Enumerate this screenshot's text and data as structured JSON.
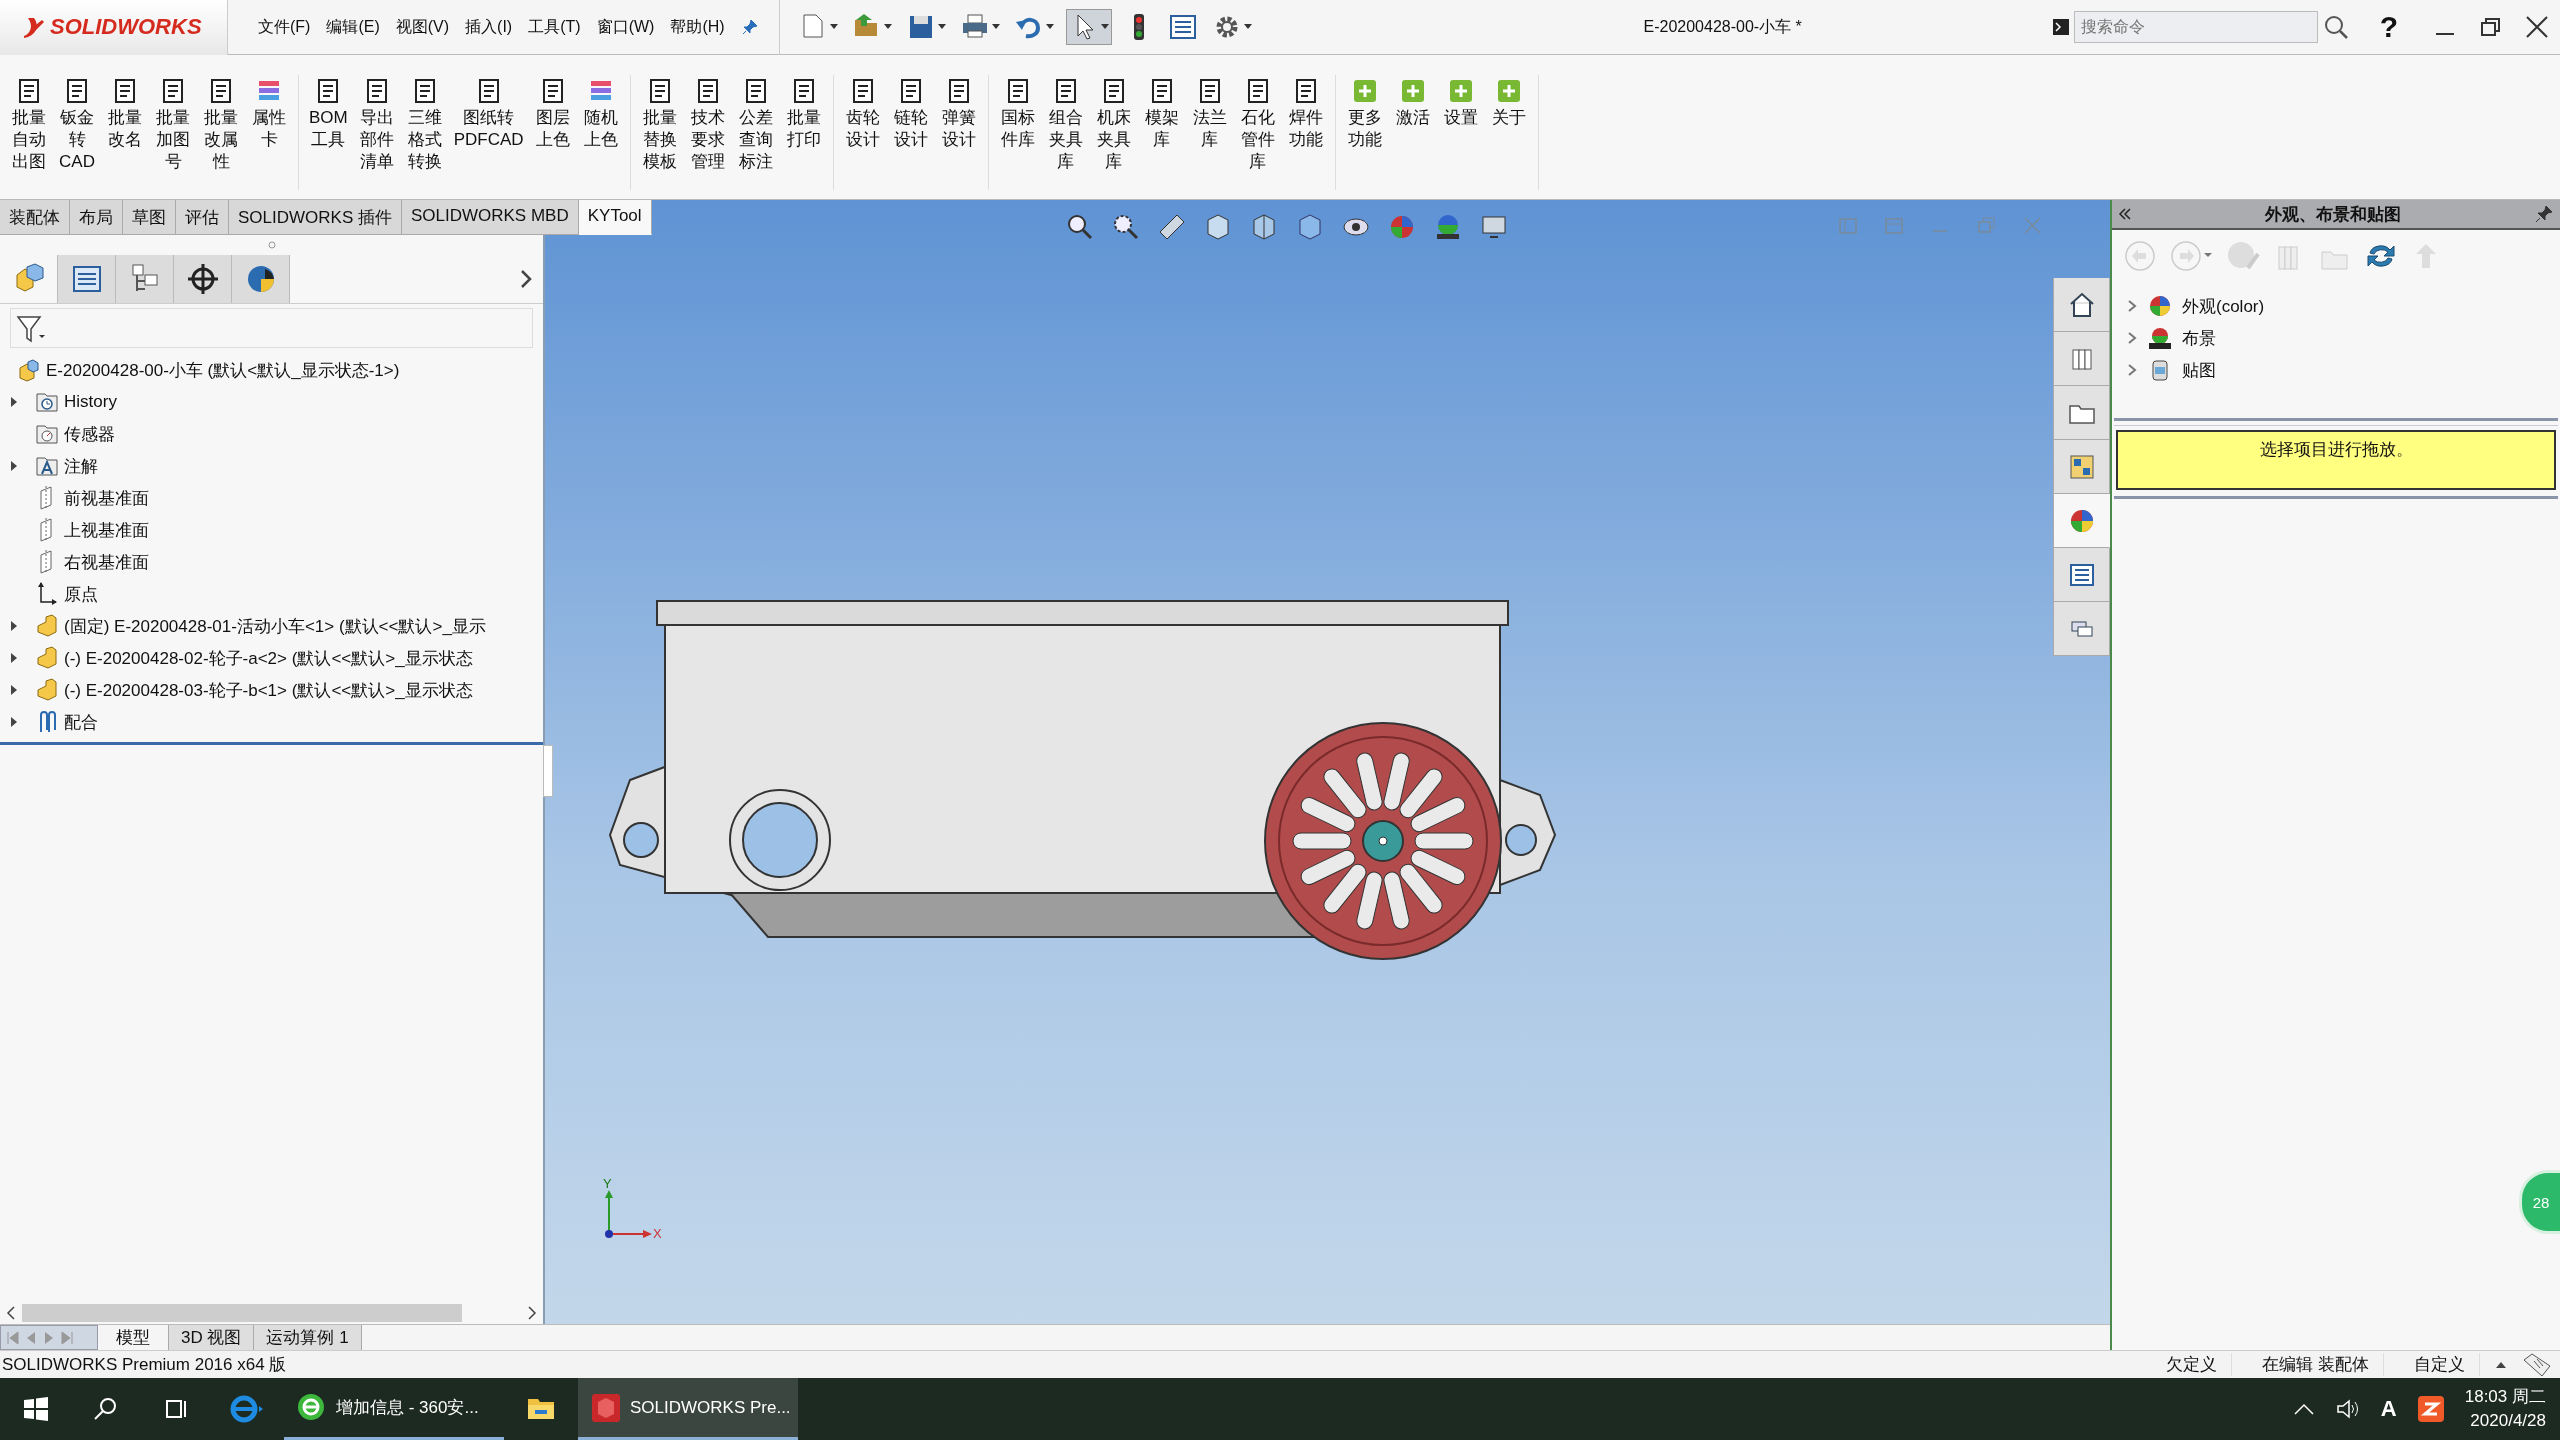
{
  "logo": {
    "text": "SOLIDWORKS"
  },
  "menu": [
    "文件(F)",
    "编辑(E)",
    "视图(V)",
    "插入(I)",
    "工具(T)",
    "窗口(W)",
    "帮助(H)"
  ],
  "window": {
    "title": "E-20200428-00-小车 *"
  },
  "search": {
    "placeholder": "搜索命令"
  },
  "help": "?",
  "ribbon": {
    "groups": [
      [
        {
          "kind": "tool",
          "lines": [
            "批量",
            "自动",
            "出图"
          ]
        },
        {
          "kind": "tool",
          "lines": [
            "钣金",
            "转",
            "CAD"
          ]
        },
        {
          "kind": "tool",
          "lines": [
            "批量",
            "改名"
          ]
        },
        {
          "kind": "tool",
          "lines": [
            "批量",
            "加图",
            "号"
          ]
        },
        {
          "kind": "tool",
          "lines": [
            "批量",
            "改属",
            "性"
          ]
        },
        {
          "kind": "color",
          "lines": [
            "属性",
            "卡"
          ]
        }
      ],
      [
        {
          "kind": "tool",
          "lines": [
            "BOM",
            "工具"
          ]
        },
        {
          "kind": "tool",
          "lines": [
            "导出",
            "部件",
            "清单"
          ]
        },
        {
          "kind": "tool",
          "lines": [
            "三维",
            "格式",
            "转换"
          ]
        },
        {
          "kind": "tool",
          "lines": [
            "图纸转",
            "PDFCAD"
          ]
        },
        {
          "kind": "tool",
          "lines": [
            "图层",
            "上色"
          ]
        },
        {
          "kind": "color",
          "lines": [
            "随机",
            "上色"
          ]
        }
      ],
      [
        {
          "kind": "tool",
          "lines": [
            "批量",
            "替换",
            "模板"
          ]
        },
        {
          "kind": "tool",
          "lines": [
            "技术",
            "要求",
            "管理"
          ]
        },
        {
          "kind": "tool",
          "lines": [
            "公差",
            "查询",
            "标注"
          ]
        },
        {
          "kind": "tool",
          "lines": [
            "批量",
            "打印"
          ]
        }
      ],
      [
        {
          "kind": "tool",
          "lines": [
            "齿轮",
            "设计"
          ]
        },
        {
          "kind": "tool",
          "lines": [
            "链轮",
            "设计"
          ]
        },
        {
          "kind": "tool",
          "lines": [
            "弹簧",
            "设计"
          ]
        }
      ],
      [
        {
          "kind": "tool",
          "lines": [
            "国标",
            "件库"
          ]
        },
        {
          "kind": "tool",
          "lines": [
            "组合",
            "夹具",
            "库"
          ]
        },
        {
          "kind": "tool",
          "lines": [
            "机床",
            "夹具",
            "库"
          ]
        },
        {
          "kind": "tool",
          "lines": [
            "模架",
            "库"
          ]
        },
        {
          "kind": "tool",
          "lines": [
            "法兰",
            "库"
          ]
        },
        {
          "kind": "tool",
          "lines": [
            "石化",
            "管件",
            "库"
          ]
        },
        {
          "kind": "tool",
          "lines": [
            "焊件",
            "功能"
          ]
        }
      ],
      [
        {
          "kind": "addon",
          "lines": [
            "更多",
            "功能"
          ]
        },
        {
          "kind": "addon",
          "lines": [
            "激活"
          ]
        },
        {
          "kind": "addon",
          "lines": [
            "设置"
          ]
        },
        {
          "kind": "addon",
          "lines": [
            "关于"
          ]
        }
      ]
    ]
  },
  "command_tabs": [
    {
      "label": "装配体",
      "selected": false
    },
    {
      "label": "布局",
      "selected": false
    },
    {
      "label": "草图",
      "selected": false
    },
    {
      "label": "评估",
      "selected": false
    },
    {
      "label": "SOLIDWORKS 插件",
      "selected": false
    },
    {
      "label": "SOLIDWORKS MBD",
      "selected": false
    },
    {
      "label": "KYTool",
      "selected": true
    }
  ],
  "panel_tabs": [
    {
      "kind": "features",
      "selected": true
    },
    {
      "kind": "properties",
      "selected": false
    },
    {
      "kind": "config",
      "selected": false
    },
    {
      "kind": "dimxpert",
      "selected": false
    },
    {
      "kind": "display",
      "selected": false
    }
  ],
  "tree": {
    "root": {
      "kind": "assembly",
      "label": "E-20200428-00-小车 (默认<默认_显示状态-1>)",
      "children": [
        {
          "kind": "history",
          "label": "History",
          "expanded": false
        },
        {
          "kind": "sensor",
          "label": "传感器"
        },
        {
          "kind": "annotation",
          "label": "注解",
          "expanded": false
        },
        {
          "kind": "plane",
          "label": "前视基准面"
        },
        {
          "kind": "plane",
          "label": "上视基准面"
        },
        {
          "kind": "plane",
          "label": "右视基准面"
        },
        {
          "kind": "origin",
          "label": "原点"
        },
        {
          "kind": "part",
          "label": "(固定) E-20200428-01-活动小车<1> (默认<<默认>_显示",
          "expanded": false
        },
        {
          "kind": "part",
          "label": "(-) E-20200428-02-轮子-a<2> (默认<<默认>_显示状态",
          "expanded": false
        },
        {
          "kind": "part",
          "label": "(-) E-20200428-03-轮子-b<1> (默认<<默认>_显示状态",
          "expanded": false
        },
        {
          "kind": "mates",
          "label": "配合",
          "expanded": false
        }
      ]
    }
  },
  "viewport": {
    "triad": {
      "x": "X",
      "y": "Y"
    }
  },
  "task_tabs": [
    {
      "kind": "home",
      "selected": false
    },
    {
      "kind": "library",
      "selected": false
    },
    {
      "kind": "folder",
      "selected": false
    },
    {
      "kind": "palette",
      "selected": false
    },
    {
      "kind": "appearance",
      "selected": true
    },
    {
      "kind": "properties",
      "selected": false
    },
    {
      "kind": "forum",
      "selected": false
    }
  ],
  "task_pane": {
    "title": "外观、布景和贴图",
    "items": [
      {
        "kind": "appearance",
        "label": "外观(color)",
        "expanded": false
      },
      {
        "kind": "scene",
        "label": "布景",
        "expanded": false
      },
      {
        "kind": "decal",
        "label": "贴图",
        "expanded": false
      }
    ],
    "message": "选择项目进行拖放。"
  },
  "model_tabs": [
    {
      "label": "模型",
      "selected": true
    },
    {
      "label": "3D 视图",
      "selected": false
    },
    {
      "label": "运动算例 1",
      "selected": false
    }
  ],
  "status_bar": {
    "text": "SOLIDWORKS Premium 2016 x64 版",
    "fields": [
      "欠定义",
      "在编辑 装配体",
      "自定义"
    ]
  },
  "badge": "28",
  "taskbar": {
    "apps": [
      {
        "kind": "ie",
        "running": false,
        "selected": false
      },
      {
        "kind": "browser",
        "label": "增加信息 - 360安...",
        "running": true,
        "selected": false
      },
      {
        "kind": "explorer",
        "running": false,
        "selected": false
      },
      {
        "kind": "solidworks",
        "label": "SOLIDWORKS Pre...",
        "running": true,
        "selected": true
      }
    ],
    "ime": "A",
    "time": "18:03 周二",
    "date": "2020/4/28"
  }
}
